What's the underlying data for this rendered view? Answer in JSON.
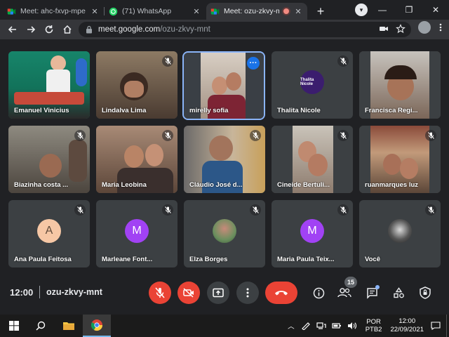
{
  "browser": {
    "tabs": [
      {
        "title": "Meet: ahc-fxvp-mpe",
        "active": false,
        "favicon": "meet-icon"
      },
      {
        "title": "(71) WhatsApp",
        "active": false,
        "favicon": "whatsapp-icon"
      },
      {
        "title": "Meet: ozu-zkvy-mnt",
        "active": true,
        "favicon": "meet-icon",
        "recording": true
      }
    ],
    "url_host": "meet.google.com",
    "url_path": "/ozu-zkvy-mnt"
  },
  "meet": {
    "participants": [
      {
        "name": "Emanuel Vinicius",
        "video": true,
        "muted": false
      },
      {
        "name": "Lindalva Lima",
        "video": true,
        "muted": true
      },
      {
        "name": "mirelly sofia",
        "video": true,
        "muted": false,
        "speaking": true
      },
      {
        "name": "Thalita Nicole",
        "video": false,
        "muted": true,
        "avatar_text": "Thalita Nicole",
        "avatar_color": "#3b1d6e"
      },
      {
        "name": "Francisca Regi...",
        "video": true,
        "muted": false
      },
      {
        "name": "Biazinha costa ...",
        "video": true,
        "muted": true
      },
      {
        "name": "Maria Leobina",
        "video": true,
        "muted": true
      },
      {
        "name": "Cláudio José d...",
        "video": true,
        "muted": true
      },
      {
        "name": "Cineide Bertuli...",
        "video": true,
        "muted": true
      },
      {
        "name": "ruanmarques luz",
        "video": true,
        "muted": true
      },
      {
        "name": "Ana Paula Feitosa",
        "video": false,
        "muted": true,
        "avatar_text": "A",
        "avatar_color": "#f6c7a5"
      },
      {
        "name": "Marleane Font...",
        "video": false,
        "muted": true,
        "avatar_text": "M",
        "avatar_color": "#a142f4"
      },
      {
        "name": "Elza Borges",
        "video": false,
        "muted": true,
        "avatar_text": "",
        "avatar_color": "#6b8f5e"
      },
      {
        "name": "Maria Paula Teix...",
        "video": false,
        "muted": true,
        "avatar_text": "M",
        "avatar_color": "#a142f4"
      },
      {
        "name": "Você",
        "video": false,
        "muted": true,
        "avatar_text": "",
        "avatar_color": "#555"
      }
    ],
    "time": "12:00",
    "meeting_code": "ozu-zkvy-mnt",
    "participant_count": "15"
  },
  "taskbar": {
    "lang_line1": "POR",
    "lang_line2": "PTB2",
    "time": "12:00",
    "date": "22/09/2021"
  }
}
